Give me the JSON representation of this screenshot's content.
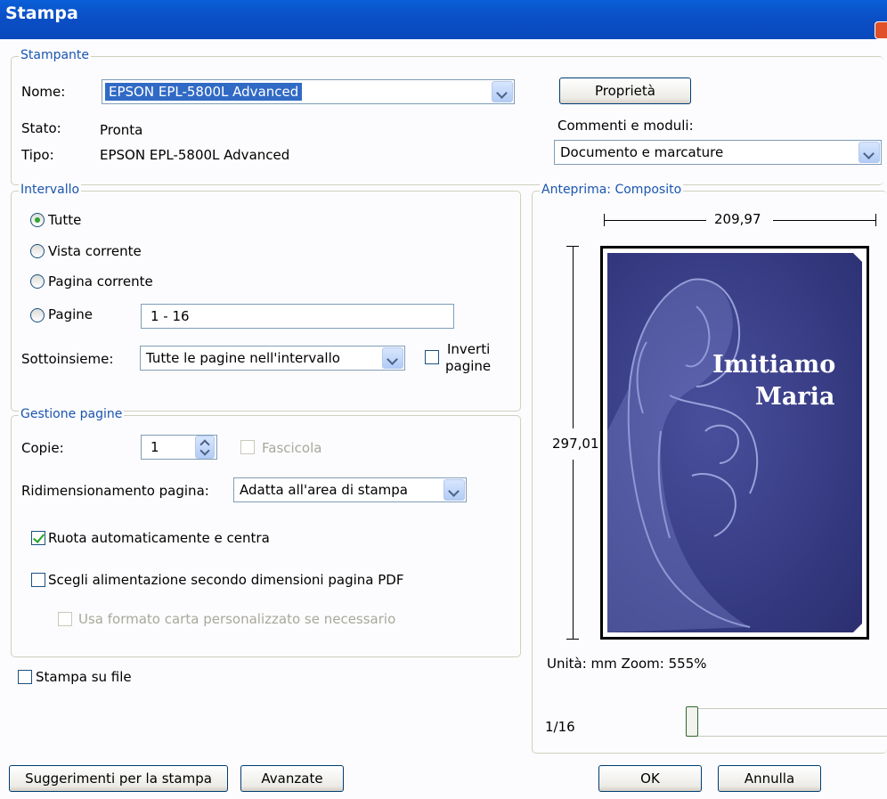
{
  "window": {
    "title": "Stampa"
  },
  "printer": {
    "group_label": "Stampante",
    "name_label": "Nome:",
    "name_value": "EPSON EPL-5800L Advanced",
    "status_label": "Stato:",
    "status_value": "Pronta",
    "type_label": "Tipo:",
    "type_value": "EPSON EPL-5800L Advanced",
    "properties_button": "Proprietà",
    "comments_label": "Commenti e moduli:",
    "comments_value": "Documento e marcature"
  },
  "range": {
    "group_label": "Intervallo",
    "options": [
      "Tutte",
      "Vista corrente",
      "Pagina corrente",
      "Pagine"
    ],
    "selected": "Tutte",
    "pages_value": "1 - 16",
    "subset_label": "Sottoinsieme:",
    "subset_value": "Tutte le pagine nell'intervallo",
    "reverse_label_1": "Inverti",
    "reverse_label_2": "pagine",
    "reverse_checked": false
  },
  "page_handling": {
    "group_label": "Gestione pagine",
    "copies_label": "Copie:",
    "copies_value": "1",
    "collate_label": "Fascicola",
    "collate_checked": false,
    "scaling_label": "Ridimensionamento pagina:",
    "scaling_value": "Adatta all'area di stampa",
    "auto_rotate_label": "Ruota automaticamente e centra",
    "auto_rotate_checked": true,
    "paper_source_label": "Scegli alimentazione secondo dimensioni pagina PDF",
    "paper_source_checked": false,
    "custom_paper_label": "Usa formato carta personalizzato se necessario",
    "custom_paper_checked": false
  },
  "print_to_file": {
    "label": "Stampa su file",
    "checked": false
  },
  "preview": {
    "group_label": "Anteprima: Composito",
    "width_value": "209,97",
    "height_value": "297,01",
    "cover_line_1": "Imitiamo",
    "cover_line_2": "Maria",
    "units_text": "Unità: mm Zoom: 555%",
    "page_counter": "1/16",
    "page_position": 1,
    "page_total": 16
  },
  "footer": {
    "tips_button": "Suggerimenti per la stampa",
    "advanced_button": "Avanzate",
    "ok_button": "OK",
    "cancel_button": "Annulla"
  }
}
